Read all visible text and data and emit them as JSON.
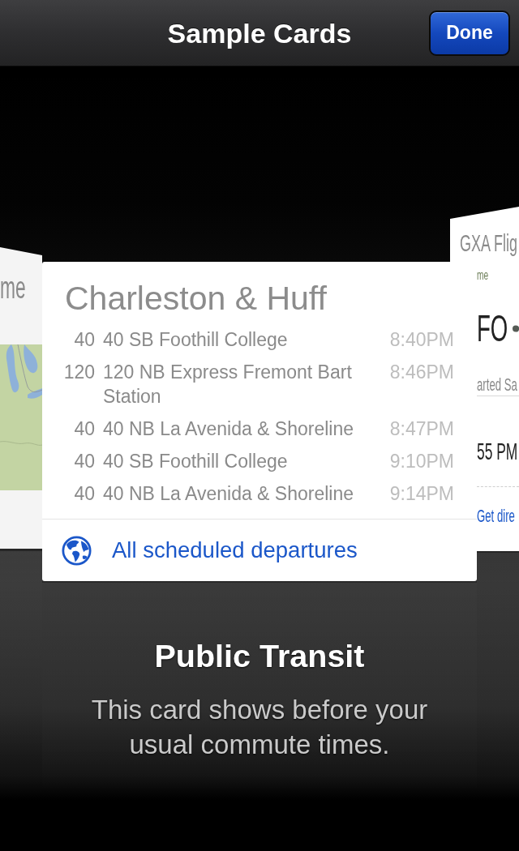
{
  "nav_bar": {
    "title": "Sample Cards",
    "done_button": "Done"
  },
  "left_card": {
    "title": "me"
  },
  "current_card": {
    "title": "Charleston & Huff",
    "departures": [
      {
        "route": "40",
        "destination": "40 SB Foothill College",
        "time": "8:40PM"
      },
      {
        "route": "120",
        "destination": "120 NB Express Fremont Bart Station",
        "time": "8:46PM"
      },
      {
        "route": "40",
        "destination": "40 NB La Avenida & Shoreline",
        "time": "8:47PM"
      },
      {
        "route": "40",
        "destination": "40 SB Foothill College",
        "time": "9:10PM"
      },
      {
        "route": "40",
        "destination": "40 NB La Avenida & Shoreline",
        "time": "9:14PM"
      }
    ],
    "link": "All scheduled departures"
  },
  "right_card": {
    "title": "GXA Flig",
    "label": "me",
    "route": "FO",
    "status": "arted Sa",
    "time": "55 PM",
    "link": "Get dire"
  },
  "caption": {
    "title": "Public Transit",
    "description": "This card shows before your usual commute times."
  }
}
